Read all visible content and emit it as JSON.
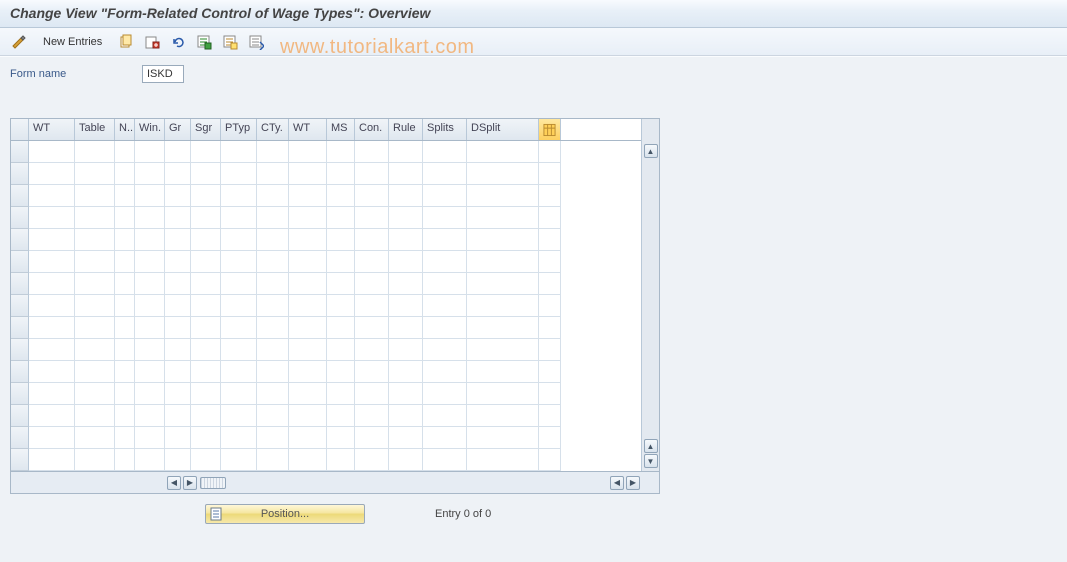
{
  "header": {
    "title": "Change View \"Form-Related Control of Wage Types\": Overview"
  },
  "toolbar": {
    "new_entries_label": "New Entries"
  },
  "watermark": "www.tutorialkart.com",
  "form": {
    "name_label": "Form name",
    "name_value": "ISKD"
  },
  "grid": {
    "columns": [
      "WT",
      "Table",
      "N..",
      "Win.",
      "Gr",
      "Sgr",
      "PTyp",
      "CTy.",
      "WT",
      "MS",
      "Con.",
      "Rule",
      "Splits",
      "DSplit"
    ],
    "row_count": 15
  },
  "footer": {
    "position_label": "Position...",
    "entry_text": "Entry 0 of 0"
  }
}
